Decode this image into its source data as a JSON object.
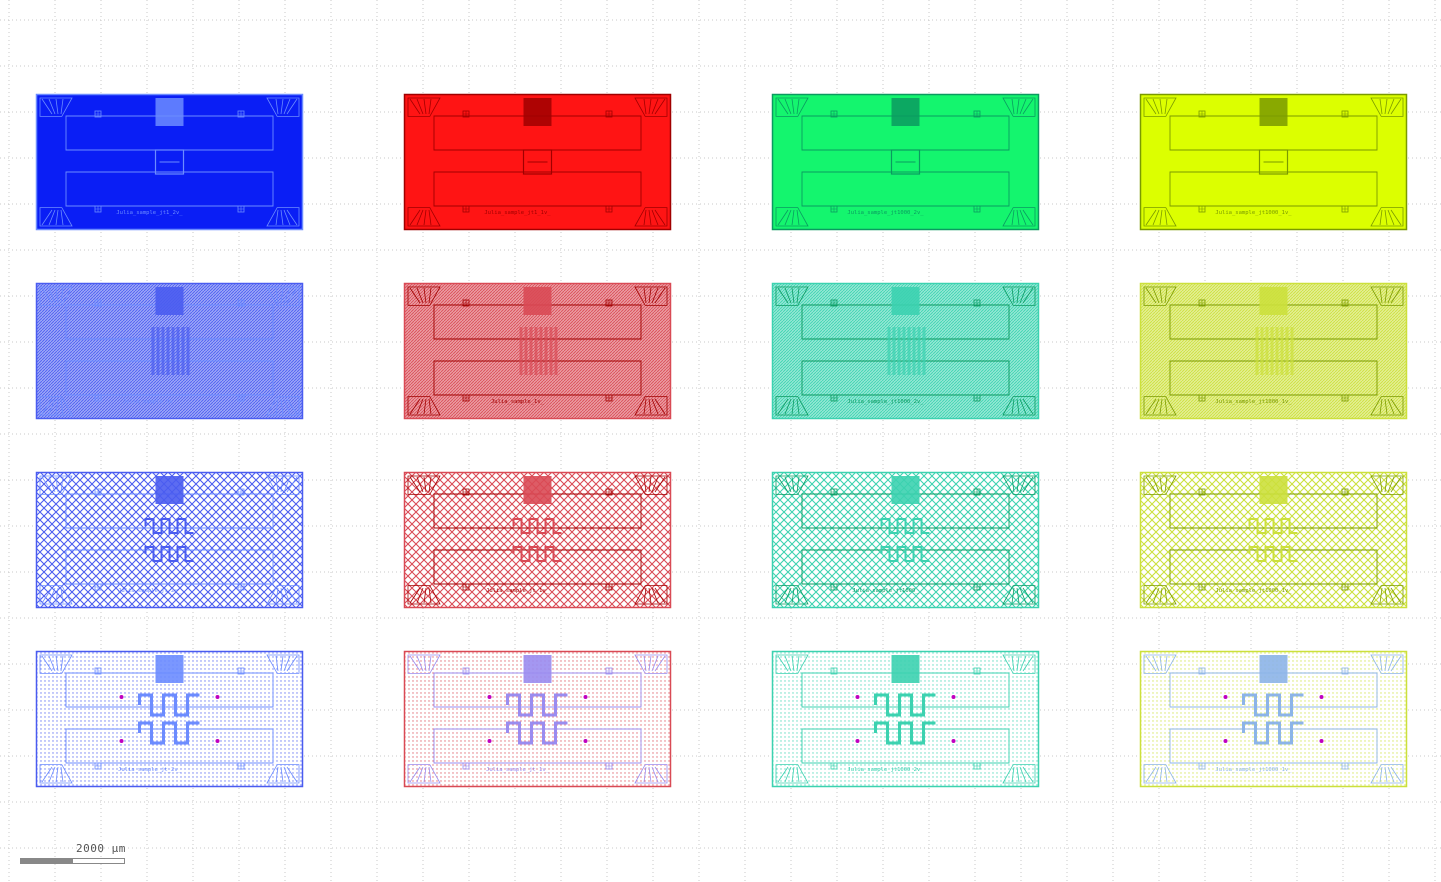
{
  "viewer": {
    "background": "#ffffff",
    "grid_dots": true,
    "grid_color": "#c8c8c8"
  },
  "scale_bar": {
    "label": "2000 µm",
    "fill_fraction": 0.5
  },
  "columns": [
    {
      "key": "blue",
      "fill": "#0a1ef5",
      "stroke": "#6c8cff",
      "light": "#4a5cf0",
      "pale": "#6c8cff"
    },
    {
      "key": "red",
      "fill": "#ff1414",
      "stroke": "#a00000",
      "light": "#d94a55",
      "pale": "#9a8cf0"
    },
    {
      "key": "green",
      "fill": "#14f56e",
      "stroke": "#0a9a60",
      "light": "#3cd2b0",
      "pale": "#3cd2b0"
    },
    {
      "key": "yellow",
      "fill": "#dcff00",
      "stroke": "#7a9a00",
      "light": "#cce03c",
      "pale": "#8cb4e8"
    }
  ],
  "rows": [
    {
      "style": "solid",
      "meander": "none"
    },
    {
      "style": "dense",
      "meander": "bars"
    },
    {
      "style": "cross",
      "meander": "small"
    },
    {
      "style": "dots",
      "meander": "large"
    }
  ],
  "chips": [
    {
      "id": "r0c0",
      "label": "Julia_sample_jt1_2v_"
    },
    {
      "id": "r0c1",
      "label": "Julia_sample_jt1_1v_"
    },
    {
      "id": "r0c2",
      "label": "Julia_sample_jt1000_2v_"
    },
    {
      "id": "r0c3",
      "label": "Julia_sample_jt1000_1v_"
    },
    {
      "id": "r1c0",
      "label": "Julia_sample_2v_"
    },
    {
      "id": "r1c1",
      "label": "Julia_sample_1v_"
    },
    {
      "id": "r1c2",
      "label": "Julia_sample_jt1000_2v_"
    },
    {
      "id": "r1c3",
      "label": "Julia_sample_jt1000_1v_"
    },
    {
      "id": "r2c0",
      "label": "Julia_sample_jt_2v_"
    },
    {
      "id": "r2c1",
      "label": "Julia_sample_jt_1v_"
    },
    {
      "id": "r2c2",
      "label": "Julia_sample_jt1000_"
    },
    {
      "id": "r2c3",
      "label": "Julia_sample_jt1000_1v_"
    },
    {
      "id": "r3c0",
      "label": "Julia_sample_jt_2v_"
    },
    {
      "id": "r3c1",
      "label": "Julia_sample_jt_1v_"
    },
    {
      "id": "r3c2",
      "label": "Julia_sample_jt1000_2v_"
    },
    {
      "id": "r3c3",
      "label": "Julia_sample_jt1000_1v_"
    }
  ]
}
